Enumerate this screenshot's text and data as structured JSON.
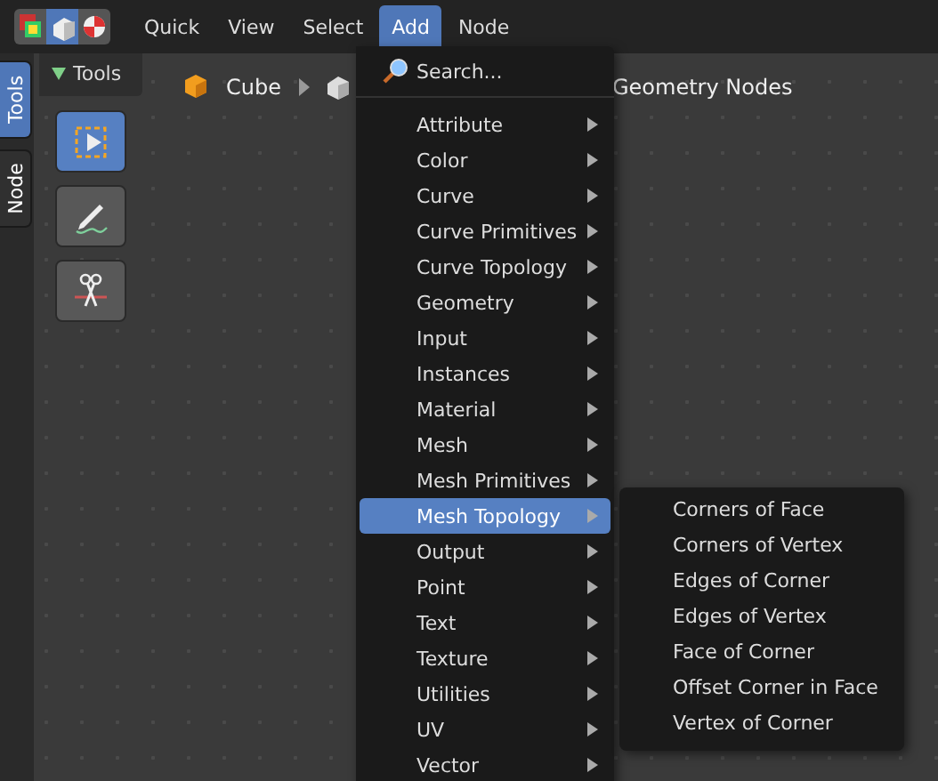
{
  "header": {
    "menus": [
      {
        "label": "Quick",
        "selected": false
      },
      {
        "label": "View",
        "selected": false
      },
      {
        "label": "Select",
        "selected": false
      },
      {
        "label": "Add",
        "selected": true
      },
      {
        "label": "Node",
        "selected": false
      }
    ]
  },
  "sidebar_tabs": [
    {
      "label": "Tools",
      "selected": true
    },
    {
      "label": "Node",
      "selected": false
    }
  ],
  "tools_panel": {
    "title": "Tools",
    "expanded": true,
    "tools": [
      {
        "kind": "select",
        "selected": true
      },
      {
        "kind": "annotate",
        "selected": false
      },
      {
        "kind": "cut",
        "selected": false
      }
    ]
  },
  "breadcrumbs": [
    {
      "kind": "object",
      "label": "Cube"
    },
    {
      "kind": "modifier"
    },
    {
      "kind": "nodetree",
      "label": "Geometry Nodes"
    }
  ],
  "add_menu": {
    "search": "Search...",
    "items": [
      {
        "label": "Attribute",
        "selected": false
      },
      {
        "label": "Color",
        "selected": false
      },
      {
        "label": "Curve",
        "selected": false
      },
      {
        "label": "Curve Primitives",
        "selected": false
      },
      {
        "label": "Curve Topology",
        "selected": false
      },
      {
        "label": "Geometry",
        "selected": false
      },
      {
        "label": "Input",
        "selected": false
      },
      {
        "label": "Instances",
        "selected": false
      },
      {
        "label": "Material",
        "selected": false
      },
      {
        "label": "Mesh",
        "selected": false
      },
      {
        "label": "Mesh Primitives",
        "selected": false
      },
      {
        "label": "Mesh Topology",
        "selected": true
      },
      {
        "label": "Output",
        "selected": false
      },
      {
        "label": "Point",
        "selected": false
      },
      {
        "label": "Text",
        "selected": false
      },
      {
        "label": "Texture",
        "selected": false
      },
      {
        "label": "Utilities",
        "selected": false
      },
      {
        "label": "UV",
        "selected": false
      },
      {
        "label": "Vector",
        "selected": false
      }
    ]
  },
  "submenu": {
    "items": [
      "Corners of Face",
      "Corners of Vertex",
      "Edges of Corner",
      "Edges of Vertex",
      "Face of Corner",
      "Offset Corner in Face",
      "Vertex of Corner"
    ]
  }
}
